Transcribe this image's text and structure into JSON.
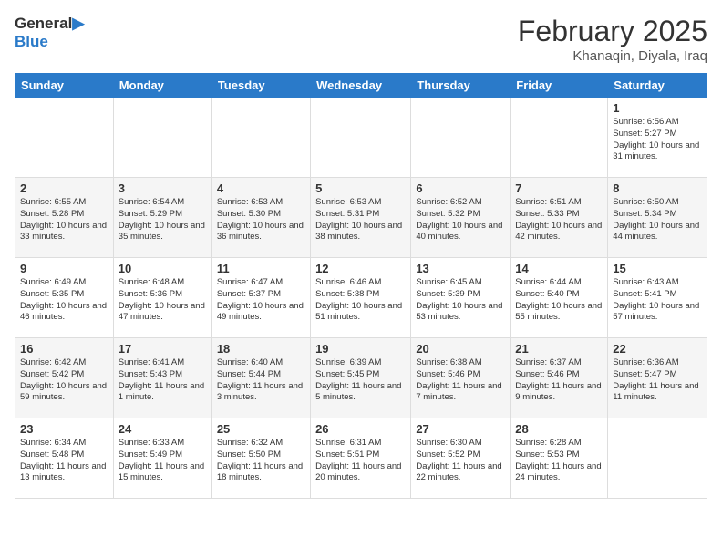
{
  "logo": {
    "line1": "General",
    "line2": "Blue"
  },
  "header": {
    "month": "February 2025",
    "location": "Khanaqin, Diyala, Iraq"
  },
  "days_of_week": [
    "Sunday",
    "Monday",
    "Tuesday",
    "Wednesday",
    "Thursday",
    "Friday",
    "Saturday"
  ],
  "weeks": [
    [
      {
        "day": "",
        "info": ""
      },
      {
        "day": "",
        "info": ""
      },
      {
        "day": "",
        "info": ""
      },
      {
        "day": "",
        "info": ""
      },
      {
        "day": "",
        "info": ""
      },
      {
        "day": "",
        "info": ""
      },
      {
        "day": "1",
        "info": "Sunrise: 6:56 AM\nSunset: 5:27 PM\nDaylight: 10 hours and 31 minutes."
      }
    ],
    [
      {
        "day": "2",
        "info": "Sunrise: 6:55 AM\nSunset: 5:28 PM\nDaylight: 10 hours and 33 minutes."
      },
      {
        "day": "3",
        "info": "Sunrise: 6:54 AM\nSunset: 5:29 PM\nDaylight: 10 hours and 35 minutes."
      },
      {
        "day": "4",
        "info": "Sunrise: 6:53 AM\nSunset: 5:30 PM\nDaylight: 10 hours and 36 minutes."
      },
      {
        "day": "5",
        "info": "Sunrise: 6:53 AM\nSunset: 5:31 PM\nDaylight: 10 hours and 38 minutes."
      },
      {
        "day": "6",
        "info": "Sunrise: 6:52 AM\nSunset: 5:32 PM\nDaylight: 10 hours and 40 minutes."
      },
      {
        "day": "7",
        "info": "Sunrise: 6:51 AM\nSunset: 5:33 PM\nDaylight: 10 hours and 42 minutes."
      },
      {
        "day": "8",
        "info": "Sunrise: 6:50 AM\nSunset: 5:34 PM\nDaylight: 10 hours and 44 minutes."
      }
    ],
    [
      {
        "day": "9",
        "info": "Sunrise: 6:49 AM\nSunset: 5:35 PM\nDaylight: 10 hours and 46 minutes."
      },
      {
        "day": "10",
        "info": "Sunrise: 6:48 AM\nSunset: 5:36 PM\nDaylight: 10 hours and 47 minutes."
      },
      {
        "day": "11",
        "info": "Sunrise: 6:47 AM\nSunset: 5:37 PM\nDaylight: 10 hours and 49 minutes."
      },
      {
        "day": "12",
        "info": "Sunrise: 6:46 AM\nSunset: 5:38 PM\nDaylight: 10 hours and 51 minutes."
      },
      {
        "day": "13",
        "info": "Sunrise: 6:45 AM\nSunset: 5:39 PM\nDaylight: 10 hours and 53 minutes."
      },
      {
        "day": "14",
        "info": "Sunrise: 6:44 AM\nSunset: 5:40 PM\nDaylight: 10 hours and 55 minutes."
      },
      {
        "day": "15",
        "info": "Sunrise: 6:43 AM\nSunset: 5:41 PM\nDaylight: 10 hours and 57 minutes."
      }
    ],
    [
      {
        "day": "16",
        "info": "Sunrise: 6:42 AM\nSunset: 5:42 PM\nDaylight: 10 hours and 59 minutes."
      },
      {
        "day": "17",
        "info": "Sunrise: 6:41 AM\nSunset: 5:43 PM\nDaylight: 11 hours and 1 minute."
      },
      {
        "day": "18",
        "info": "Sunrise: 6:40 AM\nSunset: 5:44 PM\nDaylight: 11 hours and 3 minutes."
      },
      {
        "day": "19",
        "info": "Sunrise: 6:39 AM\nSunset: 5:45 PM\nDaylight: 11 hours and 5 minutes."
      },
      {
        "day": "20",
        "info": "Sunrise: 6:38 AM\nSunset: 5:46 PM\nDaylight: 11 hours and 7 minutes."
      },
      {
        "day": "21",
        "info": "Sunrise: 6:37 AM\nSunset: 5:46 PM\nDaylight: 11 hours and 9 minutes."
      },
      {
        "day": "22",
        "info": "Sunrise: 6:36 AM\nSunset: 5:47 PM\nDaylight: 11 hours and 11 minutes."
      }
    ],
    [
      {
        "day": "23",
        "info": "Sunrise: 6:34 AM\nSunset: 5:48 PM\nDaylight: 11 hours and 13 minutes."
      },
      {
        "day": "24",
        "info": "Sunrise: 6:33 AM\nSunset: 5:49 PM\nDaylight: 11 hours and 15 minutes."
      },
      {
        "day": "25",
        "info": "Sunrise: 6:32 AM\nSunset: 5:50 PM\nDaylight: 11 hours and 18 minutes."
      },
      {
        "day": "26",
        "info": "Sunrise: 6:31 AM\nSunset: 5:51 PM\nDaylight: 11 hours and 20 minutes."
      },
      {
        "day": "27",
        "info": "Sunrise: 6:30 AM\nSunset: 5:52 PM\nDaylight: 11 hours and 22 minutes."
      },
      {
        "day": "28",
        "info": "Sunrise: 6:28 AM\nSunset: 5:53 PM\nDaylight: 11 hours and 24 minutes."
      },
      {
        "day": "",
        "info": ""
      }
    ]
  ]
}
